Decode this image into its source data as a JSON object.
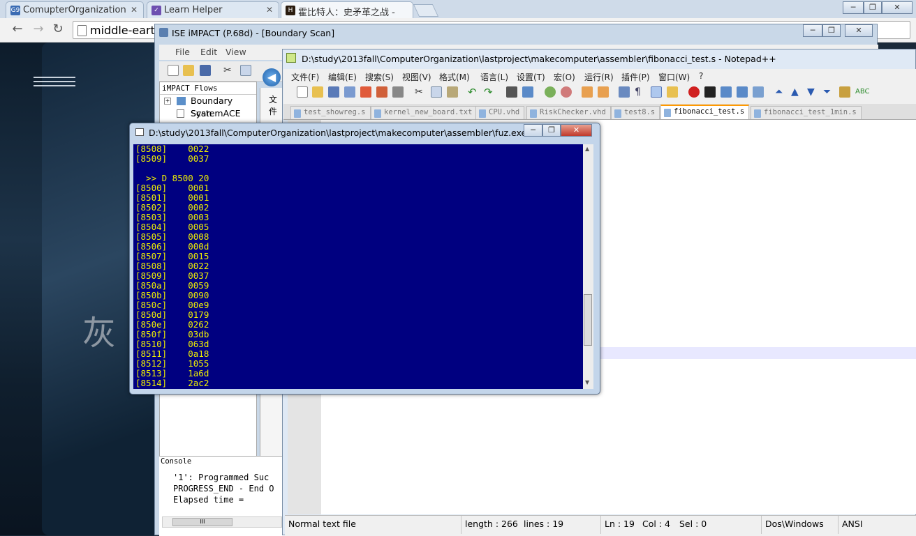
{
  "browser": {
    "tabs": [
      {
        "label": "ComupterOrganization",
        "favicon": "G9"
      },
      {
        "label": "Learn Helper",
        "favicon": "check"
      },
      {
        "label": "霍比特人：史矛革之战 - ",
        "favicon": "H"
      }
    ],
    "address": "middle-eart",
    "bg_text": "灰"
  },
  "impact": {
    "title": "ISE iMPACT (P.68d) - [Boundary Scan]",
    "menu": [
      "File",
      "Edit",
      "View"
    ],
    "flows_title": "iMPACT Flows",
    "flows": [
      "Boundary Scan",
      "SystemACE"
    ],
    "side_label": "文件",
    "console_title": "Console",
    "console_lines": [
      "'1': Programmed Suc",
      "PROGRESS_END - End O",
      "Elapsed time ="
    ],
    "scroll_mark": "III"
  },
  "notepad": {
    "title": "D:\\study\\2013fall\\ComputerOrganization\\lastproject\\makecomputer\\assembler\\fibonacci_test.s - Notepad++",
    "menu": [
      "文件(F)",
      "编辑(E)",
      "搜索(S)",
      "视图(V)",
      "格式(M)",
      "语言(L)",
      "设置(T)",
      "宏(O)",
      "运行(R)",
      "插件(P)",
      "窗口(W)",
      "?"
    ],
    "tabs": [
      "test_showreg.s",
      "kernel_new_board.txt",
      "CPU.vhd",
      "RiskChecker.vhd",
      "test8.s",
      "fibonacci_test.s",
      "fibonacci_test_1min.s"
    ],
    "active_tab": "fibonacci_test.s",
    "status": {
      "type": "Normal text file",
      "length": "length : 266",
      "lines": "lines : 19",
      "ln": "Ln : 19",
      "col": "Col : 4",
      "sel": "Sel : 0",
      "eol": "Dos\\Windows",
      "enc": "ANSI"
    }
  },
  "console": {
    "title": "D:\\study\\2013fall\\ComputerOrganization\\lastproject\\makecomputer\\assembler\\fuz.exe",
    "prev_rows": [
      {
        "addr": "[8508]",
        "val": "0022"
      },
      {
        "addr": "[8509]",
        "val": "0037"
      }
    ],
    "command": "  >> D 8500 20",
    "rows": [
      {
        "addr": "[8500]",
        "val": "0001"
      },
      {
        "addr": "[8501]",
        "val": "0001"
      },
      {
        "addr": "[8502]",
        "val": "0002"
      },
      {
        "addr": "[8503]",
        "val": "0003"
      },
      {
        "addr": "[8504]",
        "val": "0005"
      },
      {
        "addr": "[8505]",
        "val": "0008"
      },
      {
        "addr": "[8506]",
        "val": "000d"
      },
      {
        "addr": "[8507]",
        "val": "0015"
      },
      {
        "addr": "[8508]",
        "val": "0022"
      },
      {
        "addr": "[8509]",
        "val": "0037"
      },
      {
        "addr": "[850a]",
        "val": "0059"
      },
      {
        "addr": "[850b]",
        "val": "0090"
      },
      {
        "addr": "[850c]",
        "val": "00e9"
      },
      {
        "addr": "[850d]",
        "val": "0179"
      },
      {
        "addr": "[850e]",
        "val": "0262"
      },
      {
        "addr": "[850f]",
        "val": "03db"
      },
      {
        "addr": "[8510]",
        "val": "063d"
      },
      {
        "addr": "[8511]",
        "val": "0a18"
      },
      {
        "addr": "[8512]",
        "val": "1055"
      },
      {
        "addr": "[8513]",
        "val": "1a6d"
      },
      {
        "addr": "[8514]",
        "val": "2ac2"
      }
    ]
  },
  "colors": {
    "console_bg": "#000080",
    "console_fg": "#f0f000",
    "active_tab_accent": "#ff9900"
  }
}
